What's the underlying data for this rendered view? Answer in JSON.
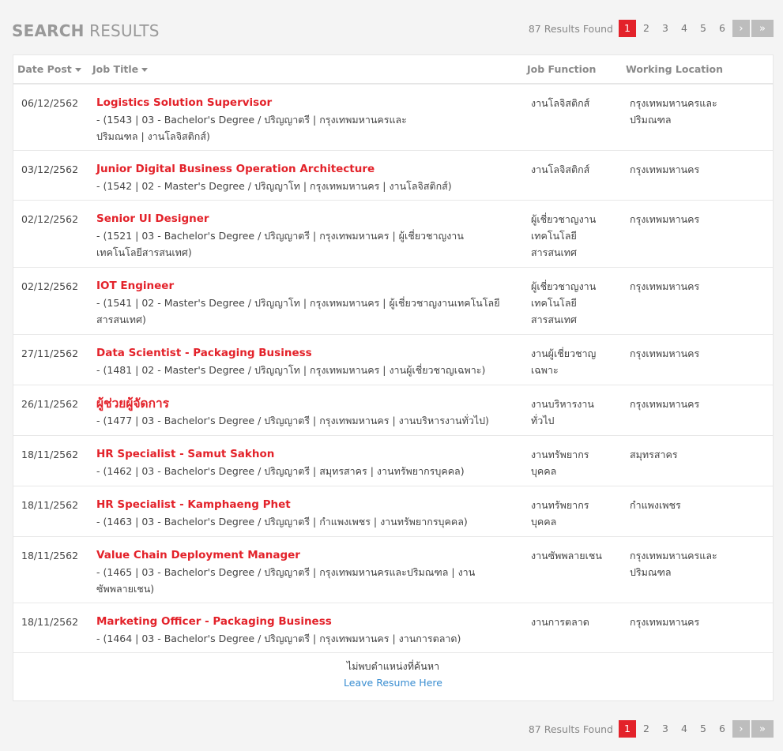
{
  "header": {
    "title_bold": "SEARCH",
    "title_light": "RESULTS"
  },
  "pagination": {
    "results_text": "87 Results Found",
    "pages": [
      "1",
      "2",
      "3",
      "4",
      "5",
      "6"
    ],
    "active_page": "1",
    "next_icon": "chevron-right-icon",
    "last_icon": "double-chevron-right-icon",
    "next_glyph": "›",
    "last_glyph": "»"
  },
  "table": {
    "columns": {
      "date": "Date Post",
      "title": "Job Title",
      "function": "Job Function",
      "location": "Working Location"
    },
    "rows": [
      {
        "date": "06/12/2562",
        "title": "Logistics Solution Supervisor",
        "desc": "- (1543 | 03 - Bachelor's Degree / ปริญญาตรี | กรุงเทพมหานครและปริมณฑล | งานโลจิสติกส์)",
        "function": "งานโลจิสติกส์",
        "location": "กรุงเทพมหานครและปริมณฑล"
      },
      {
        "date": "03/12/2562",
        "title": "Junior Digital Business Operation Architecture",
        "desc": "- (1542 | 02 - Master's Degree / ปริญญาโท | กรุงเทพมหานคร | งานโลจิสติกส์)",
        "function": "งานโลจิสติกส์",
        "location": "กรุงเทพมหานคร"
      },
      {
        "date": "02/12/2562",
        "title": "Senior UI Designer",
        "desc": "- (1521 | 03 - Bachelor's Degree / ปริญญาตรี | กรุงเทพมหานคร | ผู้เชี่ยวชาญงานเทคโนโลยีสารสนเทศ)",
        "function": "ผู้เชี่ยวชาญงานเทคโนโลยีสารสนเทศ",
        "location": "กรุงเทพมหานคร"
      },
      {
        "date": "02/12/2562",
        "title": "IOT Engineer",
        "desc": "- (1541 | 02 - Master's Degree / ปริญญาโท | กรุงเทพมหานคร | ผู้เชี่ยวชาญงานเทคโนโลยีสารสนเทศ)",
        "function": "ผู้เชี่ยวชาญงานเทคโนโลยีสารสนเทศ",
        "location": "กรุงเทพมหานคร"
      },
      {
        "date": "27/11/2562",
        "title": "Data Scientist - Packaging Business",
        "desc": "- (1481 | 02 - Master's Degree / ปริญญาโท | กรุงเทพมหานคร | งานผู้เชี่ยวชาญเฉพาะ)",
        "function": "งานผู้เชี่ยวชาญเฉพาะ",
        "location": "กรุงเทพมหานคร"
      },
      {
        "date": "26/11/2562",
        "title": "ผู้ช่วยผู้จัดการ",
        "desc": "- (1477 | 03 - Bachelor's Degree / ปริญญาตรี | กรุงเทพมหานคร | งานบริหารงานทั่วไป)",
        "function": "งานบริหารงานทั่วไป",
        "location": "กรุงเทพมหานคร"
      },
      {
        "date": "18/11/2562",
        "title": "HR Specialist - Samut Sakhon",
        "desc": "- (1462 | 03 - Bachelor's Degree / ปริญญาตรี | สมุทรสาคร | งานทรัพยากรบุคคล)",
        "function": "งานทรัพยากรบุคคล",
        "location": "สมุทรสาคร"
      },
      {
        "date": "18/11/2562",
        "title": "HR Specialist - Kamphaeng Phet",
        "desc": "- (1463 | 03 - Bachelor's Degree / ปริญญาตรี | กำแพงเพชร | งานทรัพยากรบุคคล)",
        "function": "งานทรัพยากรบุคคล",
        "location": "กำแพงเพชร"
      },
      {
        "date": "18/11/2562",
        "title": "Value Chain Deployment Manager",
        "desc": "- (1465 | 03 - Bachelor's Degree / ปริญญาตรี | กรุงเทพมหานครและปริมณฑล | งานซัพพลายเชน)",
        "function": "งานซัพพลายเชน",
        "location": "กรุงเทพมหานครและปริมณฑล"
      },
      {
        "date": "18/11/2562",
        "title": "Marketing Officer - Packaging Business",
        "desc": "- (1464 | 03 - Bachelor's Degree / ปริญญาตรี | กรุงเทพมหานคร | งานการตลาด)",
        "function": "งานการตลาด",
        "location": "กรุงเทพมหานคร"
      }
    ]
  },
  "footer": {
    "not_found_text": "ไม่พบตำแหน่งที่ค้นหา",
    "leave_resume_link": "Leave Resume Here"
  },
  "colors": {
    "accent": "#e3222a",
    "link": "#3a8ed1",
    "pager_disabled": "#bdbdbd"
  }
}
